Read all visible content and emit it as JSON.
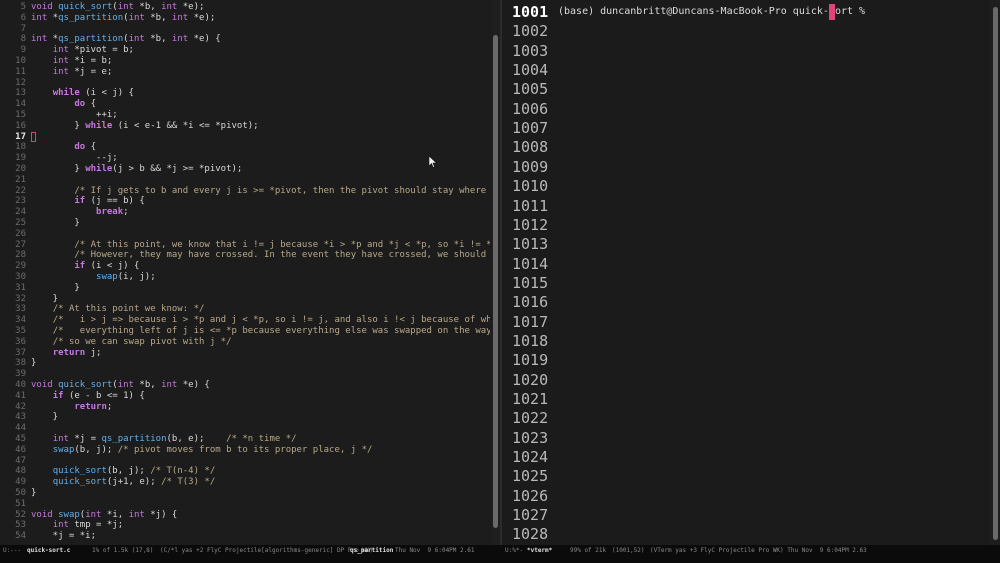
{
  "editor": {
    "current_line": "17",
    "lines": [
      {
        "n": "5",
        "text": "void quick_sort(int *b, int *e);"
      },
      {
        "n": "6",
        "text": "int *qs_partition(int *b, int *e);"
      },
      {
        "n": "7",
        "text": ""
      },
      {
        "n": "8",
        "text": "int *qs_partition(int *b, int *e) {"
      },
      {
        "n": "9",
        "text": "    int *pivot = b;"
      },
      {
        "n": "10",
        "text": "    int *i = b;"
      },
      {
        "n": "11",
        "text": "    int *j = e;"
      },
      {
        "n": "12",
        "text": ""
      },
      {
        "n": "13",
        "text": "    while (i < j) {"
      },
      {
        "n": "14",
        "text": "        do {"
      },
      {
        "n": "15",
        "text": "            ++i;"
      },
      {
        "n": "16",
        "text": "        } while (i < e-1 && *i <= *pivot);"
      },
      {
        "n": "17",
        "text": ""
      },
      {
        "n": "18",
        "text": "        do {"
      },
      {
        "n": "19",
        "text": "            --j;"
      },
      {
        "n": "20",
        "text": "        } while(j > b && *j >= *pivot);"
      },
      {
        "n": "21",
        "text": ""
      },
      {
        "n": "22",
        "text": "        /* If j gets to b and every j is >= *pivot, then the pivot should stay where it⤸"
      },
      {
        "n": "23",
        "text": "        if (j == b) {"
      },
      {
        "n": "24",
        "text": "            break;"
      },
      {
        "n": "25",
        "text": "        }"
      },
      {
        "n": "26",
        "text": ""
      },
      {
        "n": "27",
        "text": "        /* At this point, we know that i != j because *i > *p and *j < *p, so *i != *j ⤸"
      },
      {
        "n": "28",
        "text": "        /* However, they may have crossed. In the event they have crossed, we should no⤸"
      },
      {
        "n": "29",
        "text": "        if (i < j) {"
      },
      {
        "n": "30",
        "text": "            swap(i, j);"
      },
      {
        "n": "31",
        "text": "        }"
      },
      {
        "n": "32",
        "text": "    }"
      },
      {
        "n": "33",
        "text": "    /* At this point we know: */"
      },
      {
        "n": "34",
        "text": "    /*   i > j => because i > *p and j < *p, so i != j, and also i !< j because of while⤸"
      },
      {
        "n": "35",
        "text": "    /*   everything left of j is <= *p because everything else was swapped on the way t⤸"
      },
      {
        "n": "36",
        "text": "    /* so we can swap pivot with j */"
      },
      {
        "n": "37",
        "text": "    return j;"
      },
      {
        "n": "38",
        "text": "}"
      },
      {
        "n": "39",
        "text": ""
      },
      {
        "n": "40",
        "text": "void quick_sort(int *b, int *e) {"
      },
      {
        "n": "41",
        "text": "    if (e - b <= 1) {"
      },
      {
        "n": "42",
        "text": "        return;"
      },
      {
        "n": "43",
        "text": "    }"
      },
      {
        "n": "44",
        "text": ""
      },
      {
        "n": "45",
        "text": "    int *j = qs_partition(b, e);    /* *n time */"
      },
      {
        "n": "46",
        "text": "    swap(b, j); /* pivot moves from b to its proper place, j */"
      },
      {
        "n": "47",
        "text": ""
      },
      {
        "n": "48",
        "text": "    quick_sort(b, j); /* T(n-4) */"
      },
      {
        "n": "49",
        "text": "    quick_sort(j+1, e); /* T(3) */"
      },
      {
        "n": "50",
        "text": "}"
      },
      {
        "n": "51",
        "text": ""
      },
      {
        "n": "52",
        "text": "void swap(int *i, int *j) {"
      },
      {
        "n": "53",
        "text": "    int tmp = *j;"
      },
      {
        "n": "54",
        "text": "    *j = *i;"
      }
    ]
  },
  "terminal": {
    "prompt": "(base) duncanbritt@Duncans-MacBook-Pro quick-sort %",
    "current_row": "1001",
    "rows": [
      "1001",
      "1002",
      "1003",
      "1004",
      "1005",
      "1006",
      "1007",
      "1008",
      "1009",
      "1010",
      "1011",
      "1012",
      "1013",
      "1014",
      "1015",
      "1016",
      "1017",
      "1018",
      "1019",
      "1020",
      "1021",
      "1022",
      "1023",
      "1024",
      "1025",
      "1026",
      "1027",
      "1028"
    ]
  },
  "modeline": {
    "left": {
      "state": "U:---",
      "buffer": "quick-sort.c",
      "position": "1% of 1.5k (17,8)",
      "modes": "(C/*l yas +2 FlyC Projectile[algorithms-generic] DP Pro WK)",
      "function": "qs_partition",
      "time": "Thu Nov  9 6:04PM 2.61"
    },
    "right": {
      "state": "U:%*-",
      "buffer": "*vterm*",
      "position": "99% of 21k",
      "coords": "(1001,52)",
      "modes": "(VTerm yas +3 FlyC Projectile Pro WK) Thu Nov  9 6:04PM 2.63"
    }
  },
  "colors": {
    "keyword": "#c678dd",
    "comment": "#b8a888",
    "function": "#61afef",
    "cursor": "#e0437a"
  }
}
